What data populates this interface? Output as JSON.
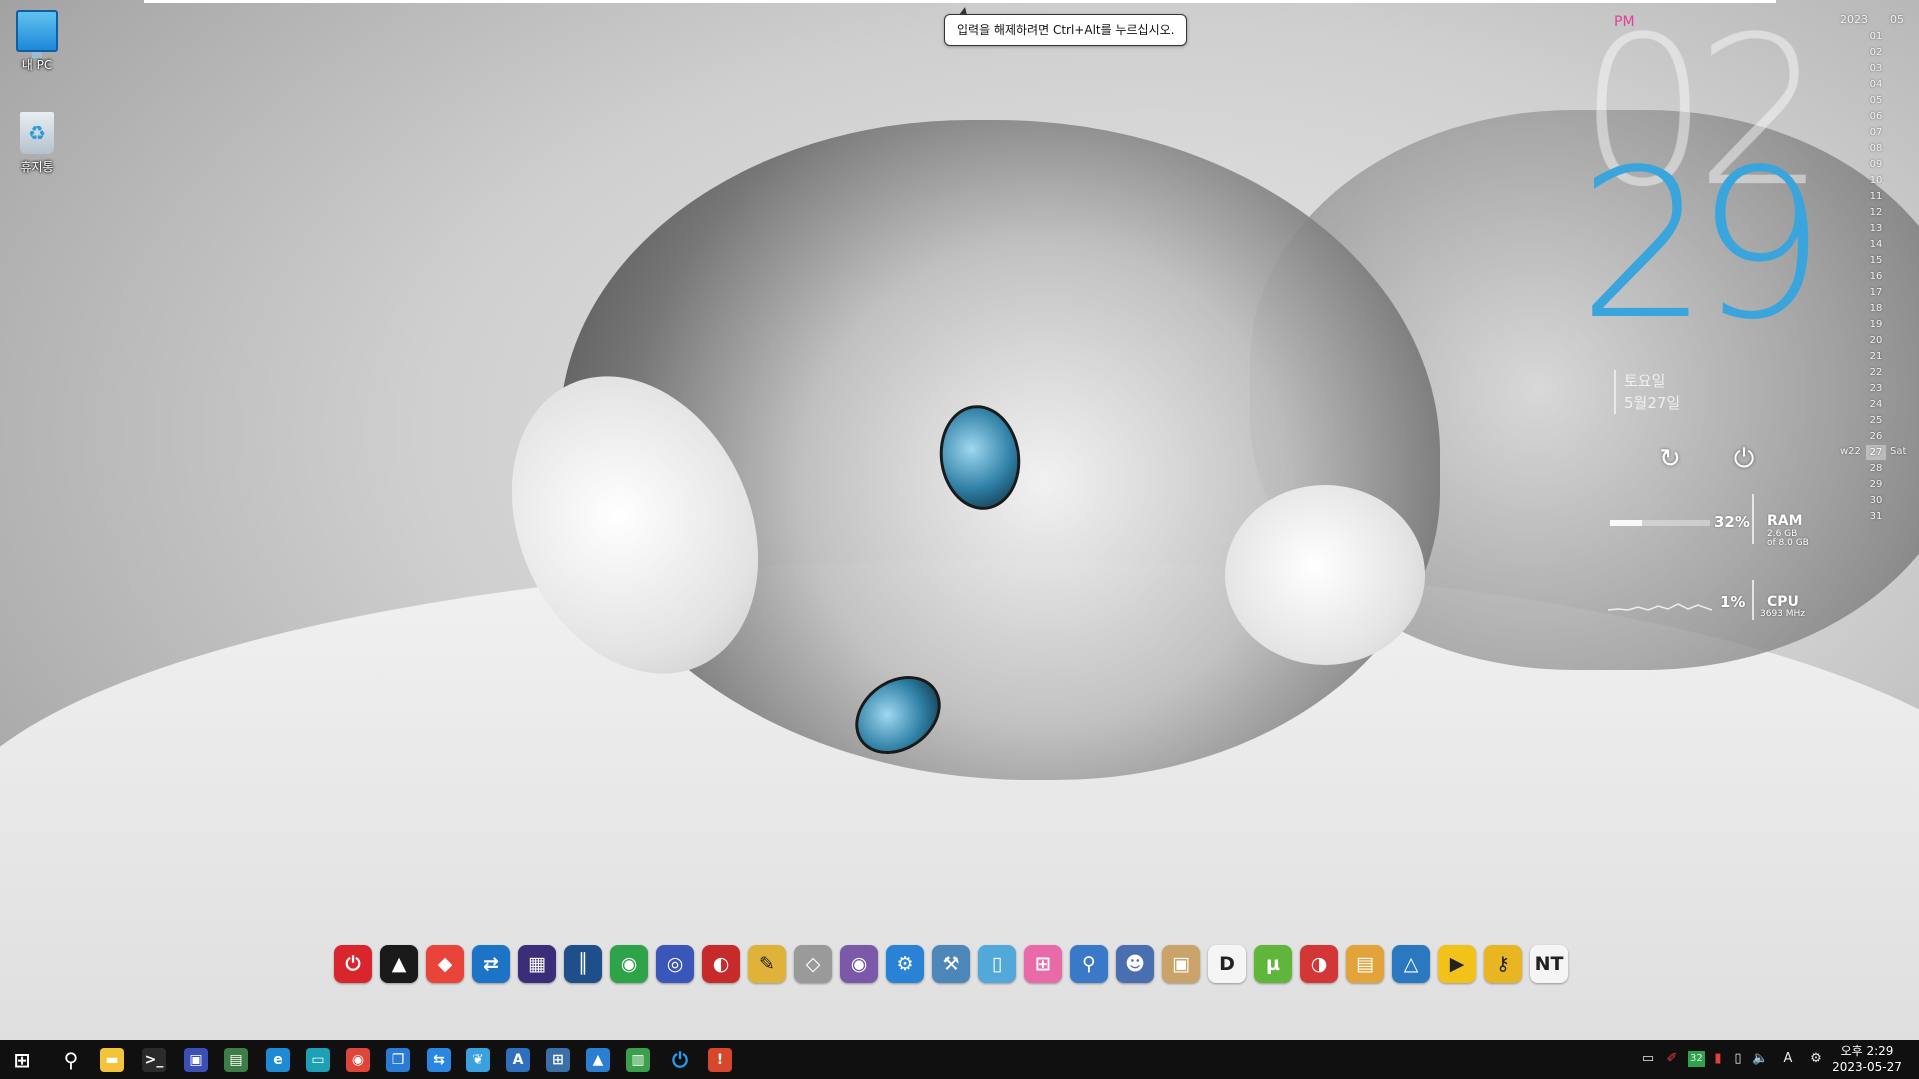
{
  "tooltip": {
    "text": "입력을 해제하려면 Ctrl+Alt를 누르십시오."
  },
  "desktop_icons": [
    {
      "label": "내 PC",
      "icon": "monitor-icon"
    },
    {
      "label": "휴지통",
      "icon": "recycle-bin-icon"
    }
  ],
  "clock_widget": {
    "ampm": "PM",
    "hour": "02",
    "minute": "29",
    "weekday": "토요일",
    "date": "5월27일",
    "accent_color": "#3aa4dc",
    "ampm_color": "#e0409a"
  },
  "meters": {
    "ram": {
      "percent_label": "32%",
      "percent": 32,
      "label": "RAM",
      "used": "2.6 GB",
      "total": "of 8.0 GB"
    },
    "cpu": {
      "percent_label": "1%",
      "percent": 1,
      "label": "CPU",
      "freq": "3693 MHz"
    }
  },
  "calendar": {
    "year": "2023",
    "month": "05",
    "days": [
      "01",
      "02",
      "03",
      "04",
      "05",
      "06",
      "07",
      "08",
      "09",
      "10",
      "11",
      "12",
      "13",
      "14",
      "15",
      "16",
      "17",
      "18",
      "19",
      "20",
      "21",
      "22",
      "23",
      "24",
      "25",
      "26",
      "27",
      "28",
      "29",
      "30",
      "31"
    ],
    "today": "27",
    "week_label": "w22",
    "today_dow": "Sat"
  },
  "dock": [
    {
      "icon": "power-off-icon",
      "bg": "#d8262c",
      "glyph": "⏻"
    },
    {
      "icon": "alert-triangle-icon",
      "bg": "#1a1a1a",
      "glyph": "▲"
    },
    {
      "icon": "anydesk-icon",
      "bg": "#e8443a",
      "glyph": "◆"
    },
    {
      "icon": "teamviewer-icon",
      "bg": "#1d74c6",
      "glyph": "⇄"
    },
    {
      "icon": "cpu-chip-icon",
      "bg": "#3b2d7a",
      "glyph": "▦"
    },
    {
      "icon": "equalizer-icon",
      "bg": "#1f4f8a",
      "glyph": "║"
    },
    {
      "icon": "disk-green-icon",
      "bg": "#2fa34a",
      "glyph": "◉"
    },
    {
      "icon": "disk-scan-icon",
      "bg": "#3a56b8",
      "glyph": "◎"
    },
    {
      "icon": "partition-icon",
      "bg": "#c72a2a",
      "glyph": "◐"
    },
    {
      "icon": "pencil-tool-icon",
      "bg": "#e0b23a",
      "glyph": "✎"
    },
    {
      "icon": "eraser-icon",
      "bg": "#9a9a9a",
      "glyph": "◇"
    },
    {
      "icon": "disc-icon",
      "bg": "#7a5aa8",
      "glyph": "◉"
    },
    {
      "icon": "gears-icon",
      "bg": "#2a82d6",
      "glyph": "⚙"
    },
    {
      "icon": "wrench-blue-icon",
      "bg": "#4d86b8",
      "glyph": "⚒"
    },
    {
      "icon": "file-blue-icon",
      "bg": "#52a8d8",
      "glyph": "▯"
    },
    {
      "icon": "windows-pink-icon",
      "bg": "#e96aa8",
      "glyph": "⊞"
    },
    {
      "icon": "magnifier-key-icon",
      "bg": "#3a78c8",
      "glyph": "⚲"
    },
    {
      "icon": "user-gear-icon",
      "bg": "#4a6fb0",
      "glyph": "☻"
    },
    {
      "icon": "package-box-icon",
      "bg": "#c9a36a",
      "glyph": "▣"
    },
    {
      "icon": "d-letter-icon",
      "bg": "#f5f5f5",
      "glyph": "D"
    },
    {
      "icon": "utorrent-icon",
      "bg": "#5fb63a",
      "glyph": "µ"
    },
    {
      "icon": "ccleaner-icon",
      "bg": "#d23636",
      "glyph": "◑"
    },
    {
      "icon": "gift-box-icon",
      "bg": "#e1a33a",
      "glyph": "▤"
    },
    {
      "icon": "prism-triangle-icon",
      "bg": "#2a78c0",
      "glyph": "△"
    },
    {
      "icon": "play-yellow-icon",
      "bg": "#f2c21a",
      "glyph": "▶"
    },
    {
      "icon": "key-icon",
      "bg": "#e8b623",
      "glyph": "⚷"
    },
    {
      "icon": "nt-crack-icon",
      "bg": "#f5f5f5",
      "glyph": "NT"
    }
  ],
  "taskbar": {
    "items": [
      {
        "icon": "windows-start-icon",
        "bg": "",
        "glyph": "⊞"
      },
      {
        "icon": "search-icon",
        "bg": "",
        "glyph": "⚲"
      },
      {
        "icon": "file-explorer-icon",
        "bg": "#f3c43a",
        "glyph": "▬"
      },
      {
        "icon": "terminal-icon",
        "bg": "#2b2b2b",
        "glyph": ">_"
      },
      {
        "icon": "floppy-save-icon",
        "bg": "#3a4fb8",
        "glyph": "▣"
      },
      {
        "icon": "network-card-icon",
        "bg": "#3e7d48",
        "glyph": "▤"
      },
      {
        "icon": "edge-browser-icon",
        "bg": "#1e8ad2",
        "glyph": "e"
      },
      {
        "icon": "monitor-teal-icon",
        "bg": "#1ea0b4",
        "glyph": "▭"
      },
      {
        "icon": "chrome-icon",
        "bg": "#e0453a",
        "glyph": "◉"
      },
      {
        "icon": "window-switch-icon",
        "bg": "#2a7bd6",
        "glyph": "❐"
      },
      {
        "icon": "arrow-swap-icon",
        "bg": "#2a86e0",
        "glyph": "⇆"
      },
      {
        "icon": "bird-icon",
        "bg": "#3aa0e0",
        "glyph": "❦"
      },
      {
        "icon": "text-a-icon",
        "bg": "#2f6fbe",
        "glyph": "A"
      },
      {
        "icon": "windows-apps-icon",
        "bg": "#3a6fa8",
        "glyph": "⊞"
      },
      {
        "icon": "photo-icon",
        "bg": "#2a7fd0",
        "glyph": "▲"
      },
      {
        "icon": "dashboard-icon",
        "bg": "#3aa04a",
        "glyph": "▥"
      },
      {
        "icon": "power-blue-icon",
        "bg": "",
        "glyph": "⏻"
      },
      {
        "icon": "alert-red-icon",
        "bg": "#d8462c",
        "glyph": "!"
      }
    ],
    "tray": [
      {
        "icon": "monitor-tray-icon",
        "glyph": "▭"
      },
      {
        "icon": "pen-red-icon",
        "glyph": "✐"
      },
      {
        "icon": "temperature-badge-icon",
        "glyph": "32"
      },
      {
        "icon": "battery-red-icon",
        "glyph": "▮"
      },
      {
        "icon": "battery-icon",
        "glyph": "▯"
      },
      {
        "icon": "volume-icon",
        "glyph": "🔈"
      },
      {
        "icon": "ime-a-icon",
        "glyph": "A"
      },
      {
        "icon": "settings-gear-icon",
        "glyph": "⚙"
      }
    ],
    "clock_time": "오후 2:29",
    "clock_date": "2023-05-27"
  }
}
